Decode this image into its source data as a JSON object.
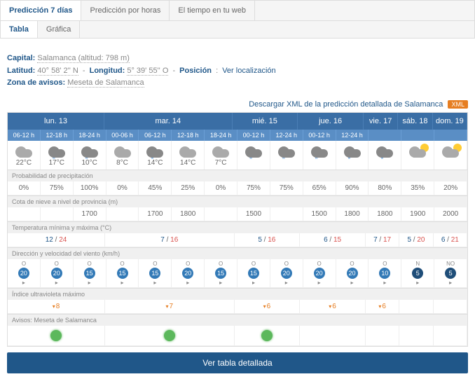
{
  "tabs": [
    "Predicción 7 días",
    "Predicción por horas",
    "El tiempo en tu web"
  ],
  "subtabs": [
    "Tabla",
    "Gráfica"
  ],
  "info": {
    "capital_label": "Capital:",
    "capital": "Salamanca (altitud: 798 m)",
    "lat_label": "Latitud:",
    "lat": "40° 58' 2'' N",
    "lon_label": "Longitud:",
    "lon": "5° 39' 55'' O",
    "pos_label": "Posición",
    "pos_link": "Ver localización",
    "zona_label": "Zona de avisos:",
    "zona": "Meseta de Salamanca"
  },
  "download": "Descargar XML de la predicción detallada de Salamanca",
  "xml": "XML",
  "days": [
    "lun. 13",
    "mar. 14",
    "mié. 15",
    "jue. 16",
    "vie. 17",
    "sáb. 18",
    "dom. 19"
  ],
  "hours": [
    "06-12 h",
    "12-18 h",
    "18-24 h",
    "00-06 h",
    "06-12 h",
    "12-18 h",
    "18-24 h",
    "00-12 h",
    "12-24 h",
    "00-12 h",
    "12-24 h",
    "",
    "",
    ""
  ],
  "temps": [
    "22°C",
    "17°C",
    "10°C",
    "8°C",
    "14°C",
    "14°C",
    "7°C",
    "",
    "",
    "",
    "",
    "",
    "",
    ""
  ],
  "labels": {
    "precip": "Probabilidad de precipitación",
    "snow": "Cota de nieve a nivel de provincia (m)",
    "minmax": "Temperatura mínima y máxima (°C)",
    "wind": "Dirección y velocidad del viento (km/h)",
    "uv": "Índice ultravioleta máximo",
    "alerts": "Avisos: Meseta de Salamanca"
  },
  "precip": [
    "0%",
    "75%",
    "100%",
    "0%",
    "45%",
    "25%",
    "0%",
    "75%",
    "75%",
    "65%",
    "90%",
    "80%",
    "35%",
    "20%"
  ],
  "snow": [
    "",
    "",
    "1700",
    "",
    "1700",
    "1800",
    "",
    "1500",
    "",
    "1500",
    "1800",
    "1800",
    "1900",
    "2000"
  ],
  "minmax": [
    {
      "s": 3,
      "min": "12",
      "max": "24"
    },
    {
      "s": 4,
      "min": "7",
      "max": "16"
    },
    {
      "s": 2,
      "min": "5",
      "max": "16"
    },
    {
      "s": 2,
      "min": "6",
      "max": "15"
    },
    {
      "s": 1,
      "min": "7",
      "max": "17"
    },
    {
      "s": 1,
      "min": "5",
      "max": "20"
    },
    {
      "s": 1,
      "min": "6",
      "max": "21"
    }
  ],
  "wind": [
    {
      "d": "O",
      "s": "20"
    },
    {
      "d": "O",
      "s": "20"
    },
    {
      "d": "O",
      "s": "15"
    },
    {
      "d": "O",
      "s": "15"
    },
    {
      "d": "O",
      "s": "15"
    },
    {
      "d": "O",
      "s": "20"
    },
    {
      "d": "O",
      "s": "15"
    },
    {
      "d": "O",
      "s": "15"
    },
    {
      "d": "O",
      "s": "20"
    },
    {
      "d": "O",
      "s": "20"
    },
    {
      "d": "O",
      "s": "20"
    },
    {
      "d": "O",
      "s": "10"
    },
    {
      "d": "N",
      "s": "5"
    },
    {
      "d": "NO",
      "s": "5"
    }
  ],
  "uv": [
    {
      "s": 3,
      "v": "8"
    },
    {
      "s": 4,
      "v": "7"
    },
    {
      "s": 2,
      "v": "6"
    },
    {
      "s": 2,
      "v": "6"
    },
    {
      "s": 1,
      "v": "6"
    },
    {
      "s": 1,
      "v": ""
    },
    {
      "s": 1,
      "v": ""
    }
  ],
  "alerts": [
    {
      "s": 3,
      "on": true
    },
    {
      "s": 4,
      "on": true
    },
    {
      "s": 2,
      "on": true
    },
    {
      "s": 2,
      "on": false
    },
    {
      "s": 1,
      "on": false
    },
    {
      "s": 1,
      "on": false
    },
    {
      "s": 1,
      "on": false
    }
  ],
  "button": "Ver tabla detallada",
  "weather": [
    "cloud",
    "rain",
    "rain",
    "cloud",
    "rain",
    "cloud",
    "cloud",
    "rain",
    "rain",
    "rain",
    "rain",
    "rain",
    "sun",
    "sun"
  ]
}
